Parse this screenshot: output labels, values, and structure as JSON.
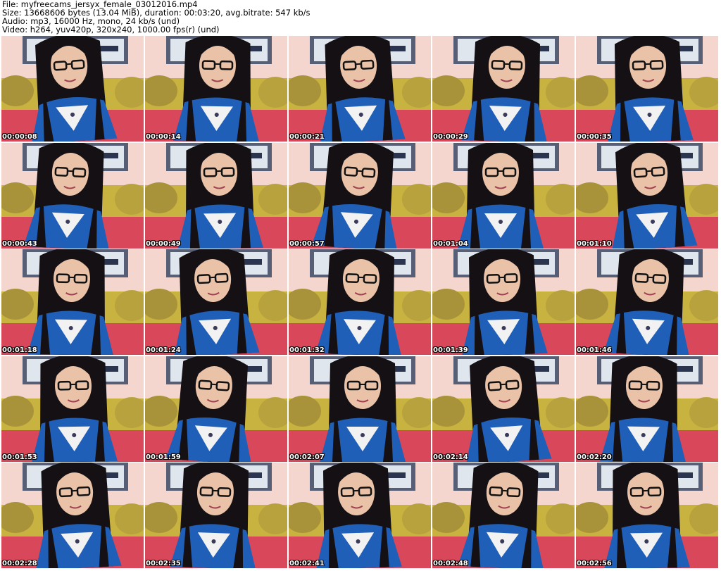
{
  "header": {
    "file_line": "File: myfreecams_jersyx_female_03012016.mp4",
    "size_line": "Size: 13668606 bytes (13.04 MiB), duration: 00:03:20, avg.bitrate: 547 kb/s",
    "audio_line": "Audio: mp3, 16000 Hz, mono, 24 kb/s (und)",
    "video_line": "Video: h264, yuv420p, 320x240, 1000.00 fps(r) (und)"
  },
  "thumbnails": [
    {
      "timestamp": "00:00:08"
    },
    {
      "timestamp": "00:00:14"
    },
    {
      "timestamp": "00:00:21"
    },
    {
      "timestamp": "00:00:29"
    },
    {
      "timestamp": "00:00:35"
    },
    {
      "timestamp": "00:00:43"
    },
    {
      "timestamp": "00:00:49"
    },
    {
      "timestamp": "00:00:57"
    },
    {
      "timestamp": "00:01:04"
    },
    {
      "timestamp": "00:01:10"
    },
    {
      "timestamp": "00:01:18"
    },
    {
      "timestamp": "00:01:24"
    },
    {
      "timestamp": "00:01:32"
    },
    {
      "timestamp": "00:01:39"
    },
    {
      "timestamp": "00:01:46"
    },
    {
      "timestamp": "00:01:53"
    },
    {
      "timestamp": "00:01:59"
    },
    {
      "timestamp": "00:02:07"
    },
    {
      "timestamp": "00:02:14"
    },
    {
      "timestamp": "00:02:20"
    },
    {
      "timestamp": "00:02:28"
    },
    {
      "timestamp": "00:02:35"
    },
    {
      "timestamp": "00:02:41"
    },
    {
      "timestamp": "00:02:48"
    },
    {
      "timestamp": "00:02:56"
    }
  ],
  "colors": {
    "wall": "#f4d6cf",
    "poster_frame": "#3a4a66",
    "pillow_gold": "#c9b340",
    "sofa_red": "#d8475a",
    "hair": "#141014",
    "skin": "#e9c2a8",
    "jacket": "#1f5fb8",
    "timestamp_text": "#ffffff"
  }
}
